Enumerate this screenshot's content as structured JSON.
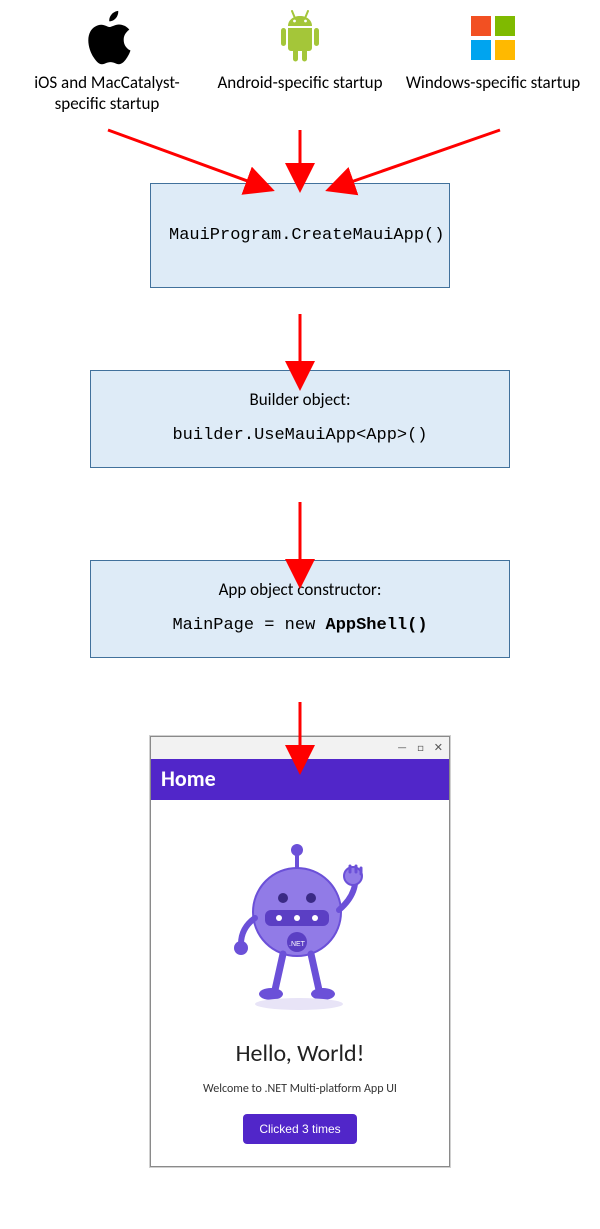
{
  "platforms": {
    "ios": {
      "label": "iOS and MacCatalyst-specific startup"
    },
    "android": {
      "label": "Android-specific startup"
    },
    "windows": {
      "label": "Windows-specific startup"
    }
  },
  "box1": {
    "code": "MauiProgram.CreateMauiApp()"
  },
  "box2": {
    "title": "Builder object:",
    "code": "builder.UseMauiApp<App>()"
  },
  "box3": {
    "title": "App object constructor:",
    "code_pre": "MainPage = new ",
    "code_bold": "AppShell()"
  },
  "app": {
    "header": "Home",
    "hello": "Hello, World!",
    "welcome": "Welcome to .NET Multi-platform App UI",
    "button": "Clicked 3 times"
  },
  "colors": {
    "arrow": "#ff0000",
    "box_fill": "#deebf7",
    "box_border": "#41719c",
    "brand": "#5126c9"
  }
}
